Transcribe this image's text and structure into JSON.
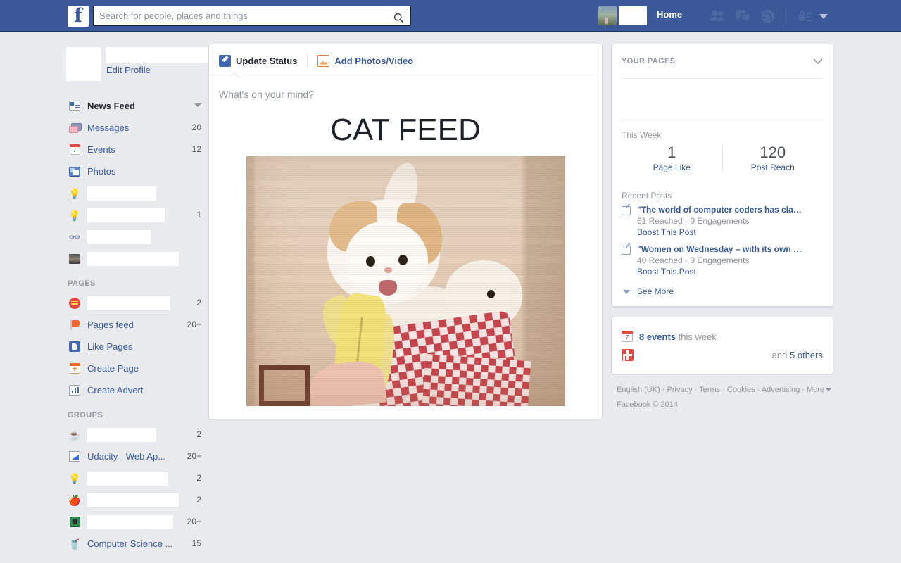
{
  "header": {
    "logo": "f",
    "search": {
      "value": "",
      "placeholder": "Search for people, places and things"
    },
    "home_label": "Home",
    "icons": {
      "search": "search-icon",
      "friend_requests": "friends-icon",
      "messages": "messages-icon",
      "notifications": "globe-icon",
      "privacy": "privacy-lock-icon",
      "account_menu": "chevron-down-icon"
    },
    "profile_name": "",
    "colors": {
      "chrome": "#3b5998",
      "chrome_border": "#133783",
      "page_bg": "#e9eaed"
    }
  },
  "sidebar": {
    "edit_profile_label": "Edit Profile",
    "favourites": [
      {
        "icon": "newsfeed-icon",
        "label": "News Feed",
        "count": "",
        "caret": true,
        "active": true
      },
      {
        "icon": "messages-icon",
        "label": "Messages",
        "count": "20",
        "caret": false,
        "active": false
      },
      {
        "icon": "events-calendar-icon",
        "label": "Events",
        "count": "12",
        "caret": false,
        "active": false,
        "day": "7"
      },
      {
        "icon": "photos-icon",
        "label": "Photos",
        "count": "",
        "caret": false,
        "active": false
      },
      {
        "icon": "lightbulb-icon",
        "label": "",
        "count": "",
        "caret": false,
        "active": false,
        "redacted": true
      },
      {
        "icon": "lightbulb-icon",
        "label": "",
        "count": "1",
        "caret": false,
        "active": false,
        "redacted": true
      },
      {
        "icon": "sunglasses-icon",
        "label": "",
        "count": "",
        "caret": false,
        "active": false,
        "redacted": true
      },
      {
        "icon": "photo-thumbnail-icon",
        "label": "",
        "count": "",
        "caret": false,
        "active": false,
        "redacted": true
      }
    ],
    "pages_heading": "PAGES",
    "pages": [
      {
        "icon": "page-badge-icon",
        "label": "",
        "count": "2",
        "redacted": true
      },
      {
        "icon": "megaphone-icon",
        "label": "Pages feed",
        "count": "20+",
        "redacted": false
      },
      {
        "icon": "thumbs-up-icon",
        "label": "Like Pages",
        "count": "",
        "redacted": false
      },
      {
        "icon": "create-page-icon",
        "label": "Create Page",
        "count": "",
        "redacted": false
      },
      {
        "icon": "bar-chart-icon",
        "label": "Create Advert",
        "count": "",
        "redacted": false
      }
    ],
    "groups_heading": "GROUPS",
    "groups": [
      {
        "icon": "coffee-mug-icon",
        "glyph": "☕",
        "label": "",
        "count": "2",
        "redacted": true
      },
      {
        "icon": "udacity-logo-icon",
        "glyph": "",
        "label": "Udacity - Web Ap...",
        "count": "20+",
        "redacted": false
      },
      {
        "icon": "lightbulb-icon",
        "glyph": "💡",
        "label": "",
        "count": "2",
        "redacted": true
      },
      {
        "icon": "apple-icon",
        "glyph": "🍎",
        "label": "",
        "count": "2",
        "redacted": true
      },
      {
        "icon": "chip-icon",
        "glyph": "",
        "label": "",
        "count": "20+",
        "redacted": true
      },
      {
        "icon": "red-cup-icon",
        "glyph": "🥤",
        "label": "Computer Science ...",
        "count": "15",
        "redacted": false
      }
    ]
  },
  "composer": {
    "tabs": [
      {
        "label": "Update Status",
        "icon": "pencil-icon",
        "active": true
      },
      {
        "label": "Add Photos/Video",
        "icon": "photo-icon",
        "active": false
      }
    ],
    "placeholder": "What's on your mind?"
  },
  "post": {
    "title": "CAT FEED",
    "image_alt": "cat-eating-banana-photo"
  },
  "right": {
    "pages_card": {
      "heading": "YOUR PAGES",
      "collapse_icon": "chevron-down-icon",
      "this_week_label": "This Week",
      "stats": [
        {
          "value": "1",
          "label": "Page Like"
        },
        {
          "value": "120",
          "label": "Post Reach"
        }
      ],
      "recent_heading": "Recent Posts",
      "recent_posts": [
        {
          "headline": "\"The world of computer coders has cla…",
          "meta": "61 Reached · 0 Engagements",
          "boost": "Boost This Post"
        },
        {
          "headline": "\"Women on Wednesday – with its own …",
          "meta": "40 Reached · 0 Engagements",
          "boost": "Boost This Post"
        }
      ],
      "see_more": "See More"
    },
    "events_card": {
      "events_count": "8 events",
      "events_suffix": "this week",
      "others_prefix": "and",
      "others_count": "5 others",
      "calendar_day": "7"
    },
    "footer": {
      "links": [
        "English (UK)",
        "Privacy",
        "Terms",
        "Cookies",
        "Advertising",
        "More"
      ],
      "copyright": "Facebook © 2014"
    }
  }
}
